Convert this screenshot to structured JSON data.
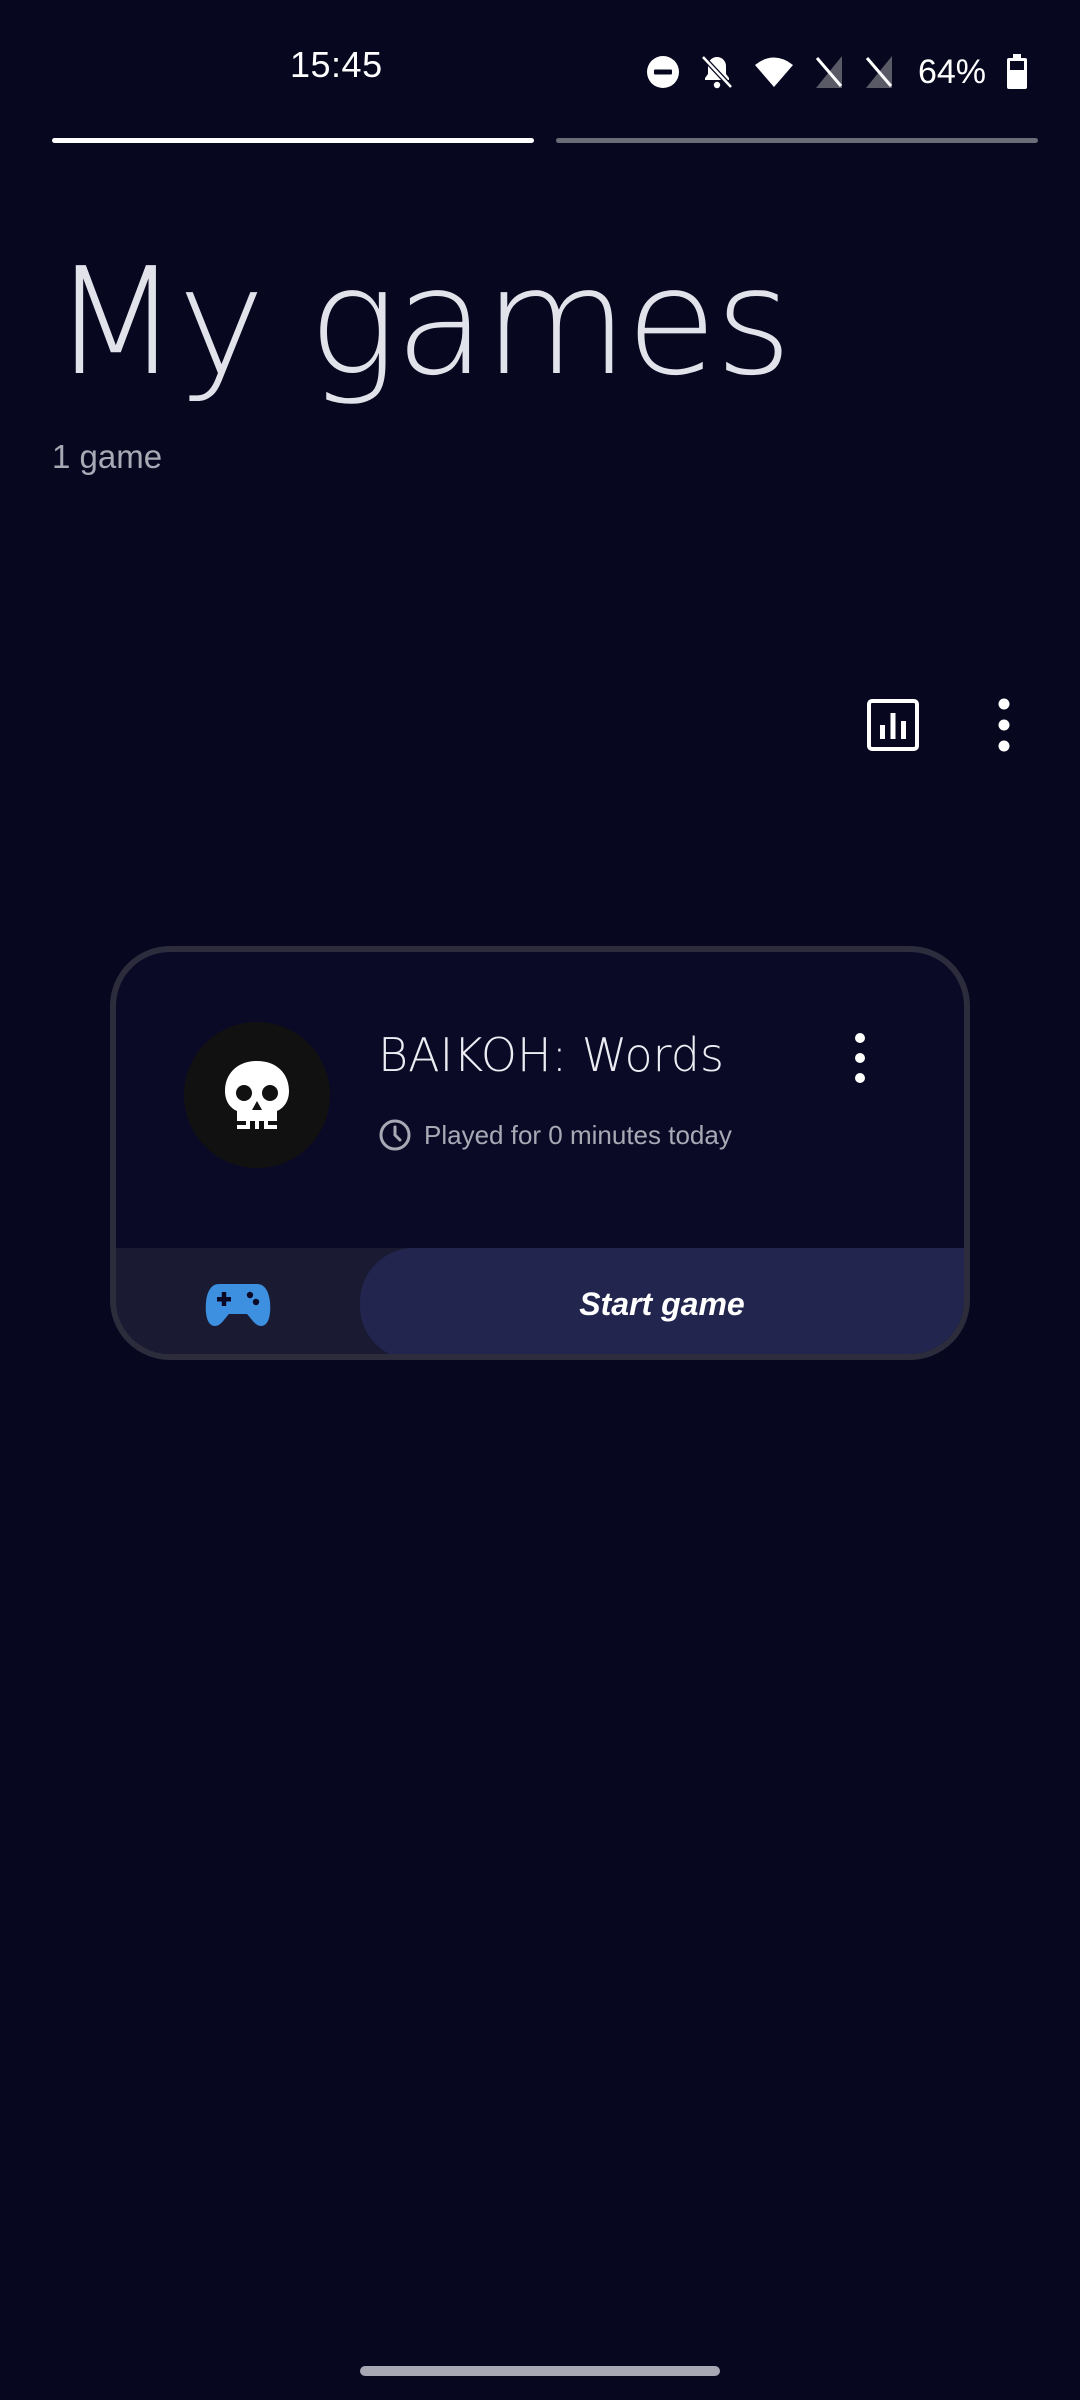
{
  "status_bar": {
    "time": "15:45",
    "battery_percent": "64%",
    "icons": [
      "do-not-disturb-icon",
      "bell-off-icon",
      "wifi-icon",
      "no-sim-icon",
      "no-sim-icon",
      "battery-icon"
    ]
  },
  "pager": {
    "pages": 2,
    "active_index": 0
  },
  "header": {
    "title": "My games",
    "count": "1 game"
  },
  "toolbar": {
    "icons": [
      "stats-icon",
      "more-vert-icon"
    ]
  },
  "games": [
    {
      "name": "BAIKOH: Words",
      "avatar_icon": "skull-icon",
      "played_text": "Played for 0 minutes today",
      "played_icon": "clock-icon",
      "start_label": "Start game",
      "controller_icon": "gamepad-icon"
    }
  ],
  "colors": {
    "background": "#070720",
    "card_border": "#2c2c3d",
    "start_button": "#22264e",
    "gamepad": "#3d8fe0"
  }
}
